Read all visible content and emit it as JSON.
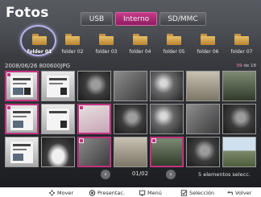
{
  "title": "Fotos",
  "source_tabs": [
    {
      "label": "USB",
      "active": false
    },
    {
      "label": "Interno",
      "active": true
    },
    {
      "label": "SD/MMC",
      "active": false
    }
  ],
  "folders": [
    {
      "label": "folder 01",
      "selected": true
    },
    {
      "label": "folder 02",
      "selected": false
    },
    {
      "label": "folder 03",
      "selected": false
    },
    {
      "label": "folder 04",
      "selected": false
    },
    {
      "label": "folder 05",
      "selected": false
    },
    {
      "label": "folder 06",
      "selected": false
    },
    {
      "label": "folder 07",
      "selected": false
    }
  ],
  "file_name": "2008/06/26 800600JPG",
  "counter": {
    "current": "09",
    "of_text": "de 18"
  },
  "pager": {
    "page": "01/02",
    "prev_icon": "chevron-left-icon",
    "next_icon": "chevron-right-icon"
  },
  "selection_count": "5 elementos selecc.",
  "hints": [
    {
      "icon": "dpad-icon",
      "label": "Mover"
    },
    {
      "icon": "ok-button-icon",
      "label": "Presentac."
    },
    {
      "icon": "menu-icon",
      "label": "Menú"
    },
    {
      "icon": "checkbox-icon",
      "label": "Selección"
    },
    {
      "icon": "return-icon",
      "label": "Volver"
    }
  ],
  "thumbnails": [
    {
      "checked": true
    },
    {
      "checked": false
    },
    {
      "checked": false
    },
    {
      "checked": false
    },
    {
      "checked": false
    },
    {
      "checked": false
    },
    {
      "checked": false
    },
    {
      "checked": true
    },
    {
      "checked": false
    },
    {
      "checked": true
    },
    {
      "checked": false
    },
    {
      "checked": false
    },
    {
      "checked": false
    },
    {
      "checked": false
    },
    {
      "checked": false
    },
    {
      "checked": false
    },
    {
      "checked": true
    },
    {
      "checked": false
    },
    {
      "checked": true
    },
    {
      "checked": false
    },
    {
      "checked": false
    }
  ],
  "colors": {
    "accent": "#c0357f",
    "selection_ring": "#b9b4ef",
    "counter_current": "#ff7fc0"
  }
}
